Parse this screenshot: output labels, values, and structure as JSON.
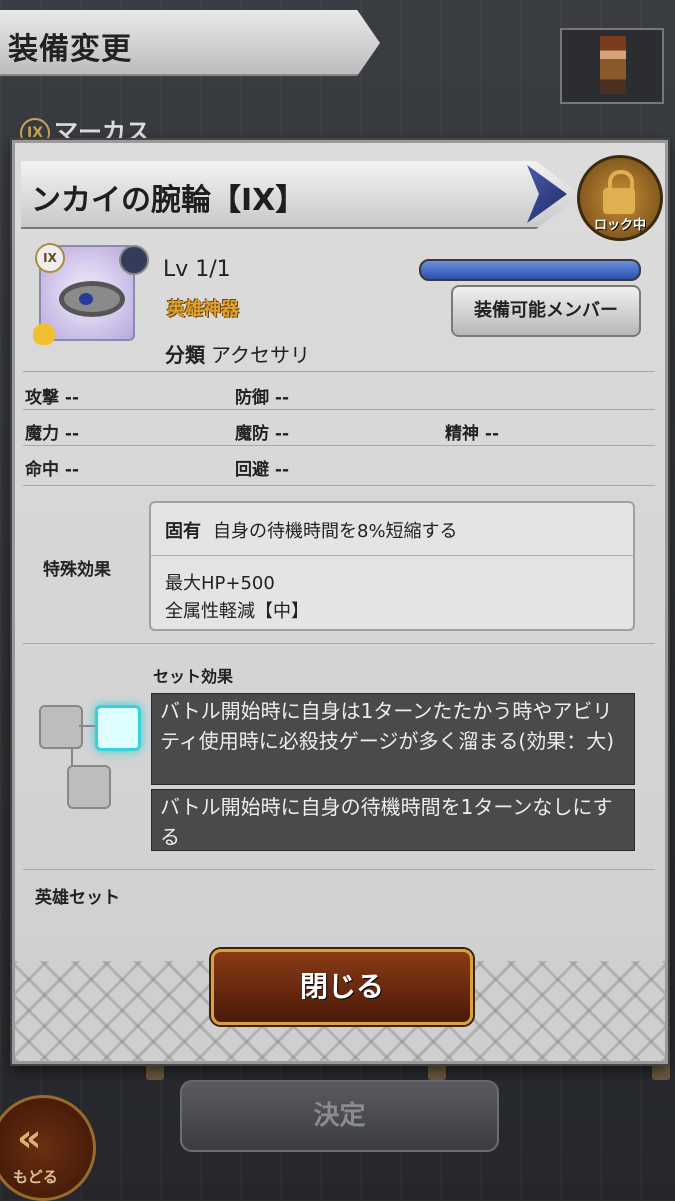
{
  "screen": {
    "title": "装備変更",
    "character_name": "マーカス",
    "character_badge": "IX"
  },
  "dialog": {
    "item_name": "ンカイの腕輪【IX】",
    "lock_label": "ロック中",
    "item_badge": "IX",
    "level": "Lv 1/1",
    "rarity": "英雄神器",
    "member_button": "装備可能メンバー",
    "category_label": "分類",
    "category_value": "アクセサリ",
    "stats": [
      {
        "label": "攻撃",
        "value": "--"
      },
      {
        "label": "防御",
        "value": "--"
      },
      {
        "label": "魔力",
        "value": "--"
      },
      {
        "label": "魔防",
        "value": "--"
      },
      {
        "label": "精神",
        "value": "--"
      },
      {
        "label": "命中",
        "value": "--"
      },
      {
        "label": "回避",
        "value": "--"
      }
    ],
    "special_label": "特殊効果",
    "special": {
      "unique_tag": "固有",
      "unique_text": "自身の待機時間を8%短縮する",
      "line2": "最大HP+500",
      "line3": "全属性軽減【中】"
    },
    "set_label": "セット効果",
    "set_effects": [
      "バトル開始時に自身は1ターンたたかう時やアビリティ使用時に必殺技ゲージが多く溜まる(効果：大)",
      "バトル開始時に自身の待機時間を1ターンなしにする"
    ],
    "hero_set_label": "英雄セット",
    "close_button": "閉じる"
  },
  "footer": {
    "decide_button": "決定",
    "back_label": "もどる",
    "back_icon": "«"
  },
  "colors": {
    "rarity": "#e0a030",
    "exp_bar": "#2c4fb0",
    "close_button": "#8a3a14",
    "active_slot": "#3ad0d8"
  }
}
